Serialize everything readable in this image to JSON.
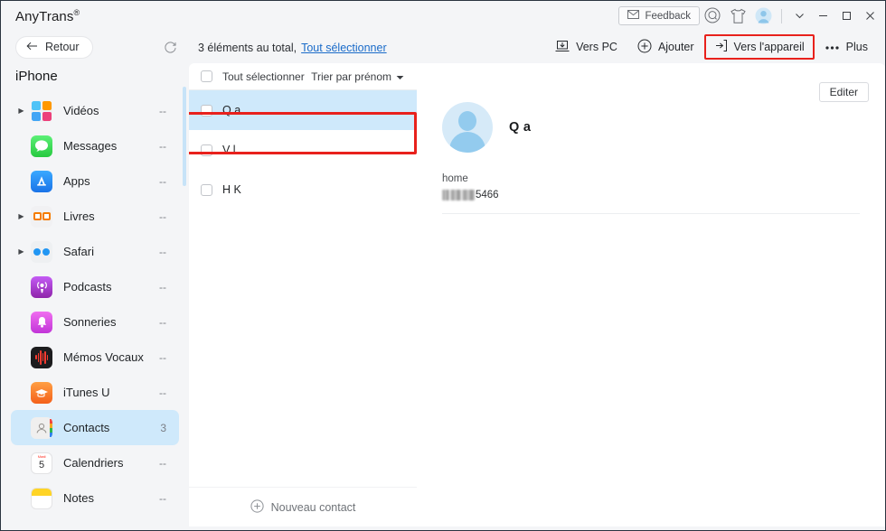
{
  "titlebar": {
    "app_name": "AnyTrans",
    "registered_mark": "®",
    "feedback_label": "Feedback",
    "icons": {
      "feedback": "envelope-icon",
      "search": "search-icon",
      "theme": "tshirt-icon",
      "account": "avatar-icon",
      "more": "chevron-down-icon",
      "minimize": "minimize-icon",
      "maximize": "maximize-icon",
      "close": "close-icon"
    }
  },
  "toolbar": {
    "back_label": "Retour",
    "refresh_icon": "refresh-icon",
    "actions": [
      {
        "label": "Vers PC",
        "icon": "to-pc-icon",
        "highlighted": false
      },
      {
        "label": "Ajouter",
        "icon": "plus-circle-icon",
        "highlighted": false
      },
      {
        "label": "Vers l'appareil",
        "icon": "to-device-icon",
        "highlighted": true
      },
      {
        "label": "Plus",
        "icon": "ellipsis-icon",
        "highlighted": false
      }
    ]
  },
  "sidebar": {
    "device_title": "iPhone",
    "items": [
      {
        "label": "Vidéos",
        "count": "--",
        "expandable": true,
        "icon": "videos-icon"
      },
      {
        "label": "Messages",
        "count": "--",
        "expandable": false,
        "icon": "messages-icon"
      },
      {
        "label": "Apps",
        "count": "--",
        "expandable": false,
        "icon": "apps-icon"
      },
      {
        "label": "Livres",
        "count": "--",
        "expandable": true,
        "icon": "books-icon"
      },
      {
        "label": "Safari",
        "count": "--",
        "expandable": true,
        "icon": "safari-icon"
      },
      {
        "label": "Podcasts",
        "count": "--",
        "expandable": false,
        "icon": "podcasts-icon"
      },
      {
        "label": "Sonneries",
        "count": "--",
        "expandable": false,
        "icon": "ringtones-icon"
      },
      {
        "label": "Mémos Vocaux",
        "count": "--",
        "expandable": false,
        "icon": "voice-memos-icon"
      },
      {
        "label": "iTunes U",
        "count": "--",
        "expandable": false,
        "icon": "itunes-u-icon"
      },
      {
        "label": "Contacts",
        "count": "3",
        "expandable": false,
        "icon": "contacts-icon",
        "active": true
      },
      {
        "label": "Calendriers",
        "count": "--",
        "expandable": false,
        "icon": "calendar-icon"
      },
      {
        "label": "Notes",
        "count": "--",
        "expandable": false,
        "icon": "notes-icon"
      }
    ],
    "calendar_icon_top": "Mardi",
    "calendar_icon_day": "5"
  },
  "list_header_bar": {
    "total_text": "3 éléments au total,",
    "select_all_link": "Tout sélectionner"
  },
  "list": {
    "select_all_label": "Tout sélectionner",
    "sort_label": "Trier par prénom",
    "rows": [
      {
        "name": "Q a",
        "selected": true,
        "checked": false
      },
      {
        "name": "V l",
        "selected": false,
        "checked": false
      },
      {
        "name": "H K",
        "selected": false,
        "checked": false
      }
    ],
    "new_contact_label": "Nouveau contact"
  },
  "detail": {
    "edit_label": "Editer",
    "contact_name": "Q a",
    "fields": [
      {
        "label": "home",
        "value_suffix": "5466",
        "redacted": true
      }
    ]
  },
  "colors": {
    "accent_selection": "#cfe9fb",
    "highlight_box": "#e8211c",
    "link": "#1a6bc9",
    "window_bg": "#f4f5f7",
    "panel_bg": "#ffffff"
  }
}
